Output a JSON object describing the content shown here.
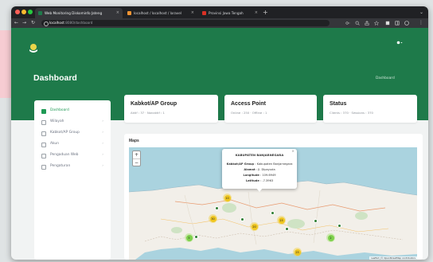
{
  "browser": {
    "tabs": [
      {
        "label": "Web Monitoring Diskominfo Jateng",
        "active": true
      },
      {
        "label": "localhost / localhost / laravel",
        "active": false
      },
      {
        "label": "Provinsi Jawa Tengah",
        "active": false
      }
    ],
    "url": {
      "host": "localhost",
      "path": ":8080/dashboard"
    }
  },
  "app": {
    "page_title": "Dashboard",
    "breadcrumb": "Dashboard",
    "sidebar": {
      "items": [
        {
          "label": "Dashboard",
          "icon": "home-icon",
          "active": true,
          "has_children": false
        },
        {
          "label": "Wilayah",
          "icon": "map-icon",
          "active": false,
          "has_children": true
        },
        {
          "label": "Kabkot/AP Group",
          "icon": "building-icon",
          "active": false,
          "has_children": true
        },
        {
          "label": "Akun",
          "icon": "user-icon",
          "active": false,
          "has_children": true
        },
        {
          "label": "Pengaduan Web",
          "icon": "message-icon",
          "active": false,
          "has_children": true
        },
        {
          "label": "Pengaturan",
          "icon": "settings-icon",
          "active": false,
          "has_children": true
        }
      ]
    },
    "cards": [
      {
        "title": "Kabkot/AP Group",
        "subtitle": "Aktif : 37 · Nonaktif : 1"
      },
      {
        "title": "Access Point",
        "subtitle": "Online : 250 · Offline : 1"
      },
      {
        "title": "Status",
        "subtitle": "Clients : 370 · Sessions : 370"
      }
    ],
    "map": {
      "title": "Maps",
      "zoom_in": "+",
      "zoom_out": "−",
      "popup": {
        "title": "KABUPATEN BANJARNEGARA",
        "close": "×",
        "lines": [
          {
            "label": "Kabkot/AP Group",
            "value": "Kabupaten Banjarnegara"
          },
          {
            "label": "Alamat",
            "value": "Jl. Dipayuda"
          },
          {
            "label": "Longitude",
            "value": "109.6949"
          },
          {
            "label": "Latitude",
            "value": "-7.3963"
          }
        ]
      },
      "clusters": [
        {
          "count": "10",
          "color": "yellow"
        },
        {
          "count": "30",
          "color": "yellow"
        },
        {
          "count": "20",
          "color": "yellow"
        },
        {
          "count": "15",
          "color": "yellow"
        },
        {
          "count": "5",
          "color": "green"
        },
        {
          "count": "25",
          "color": "yellow"
        },
        {
          "count": "2",
          "color": "green"
        }
      ],
      "attribution": "Leaflet | © OpenStreetMap contributors"
    }
  },
  "colors": {
    "brand_green": "#1e7a4a",
    "active_green": "#1f9a55",
    "sea": "#aad3df",
    "land": "#f2efe9"
  }
}
